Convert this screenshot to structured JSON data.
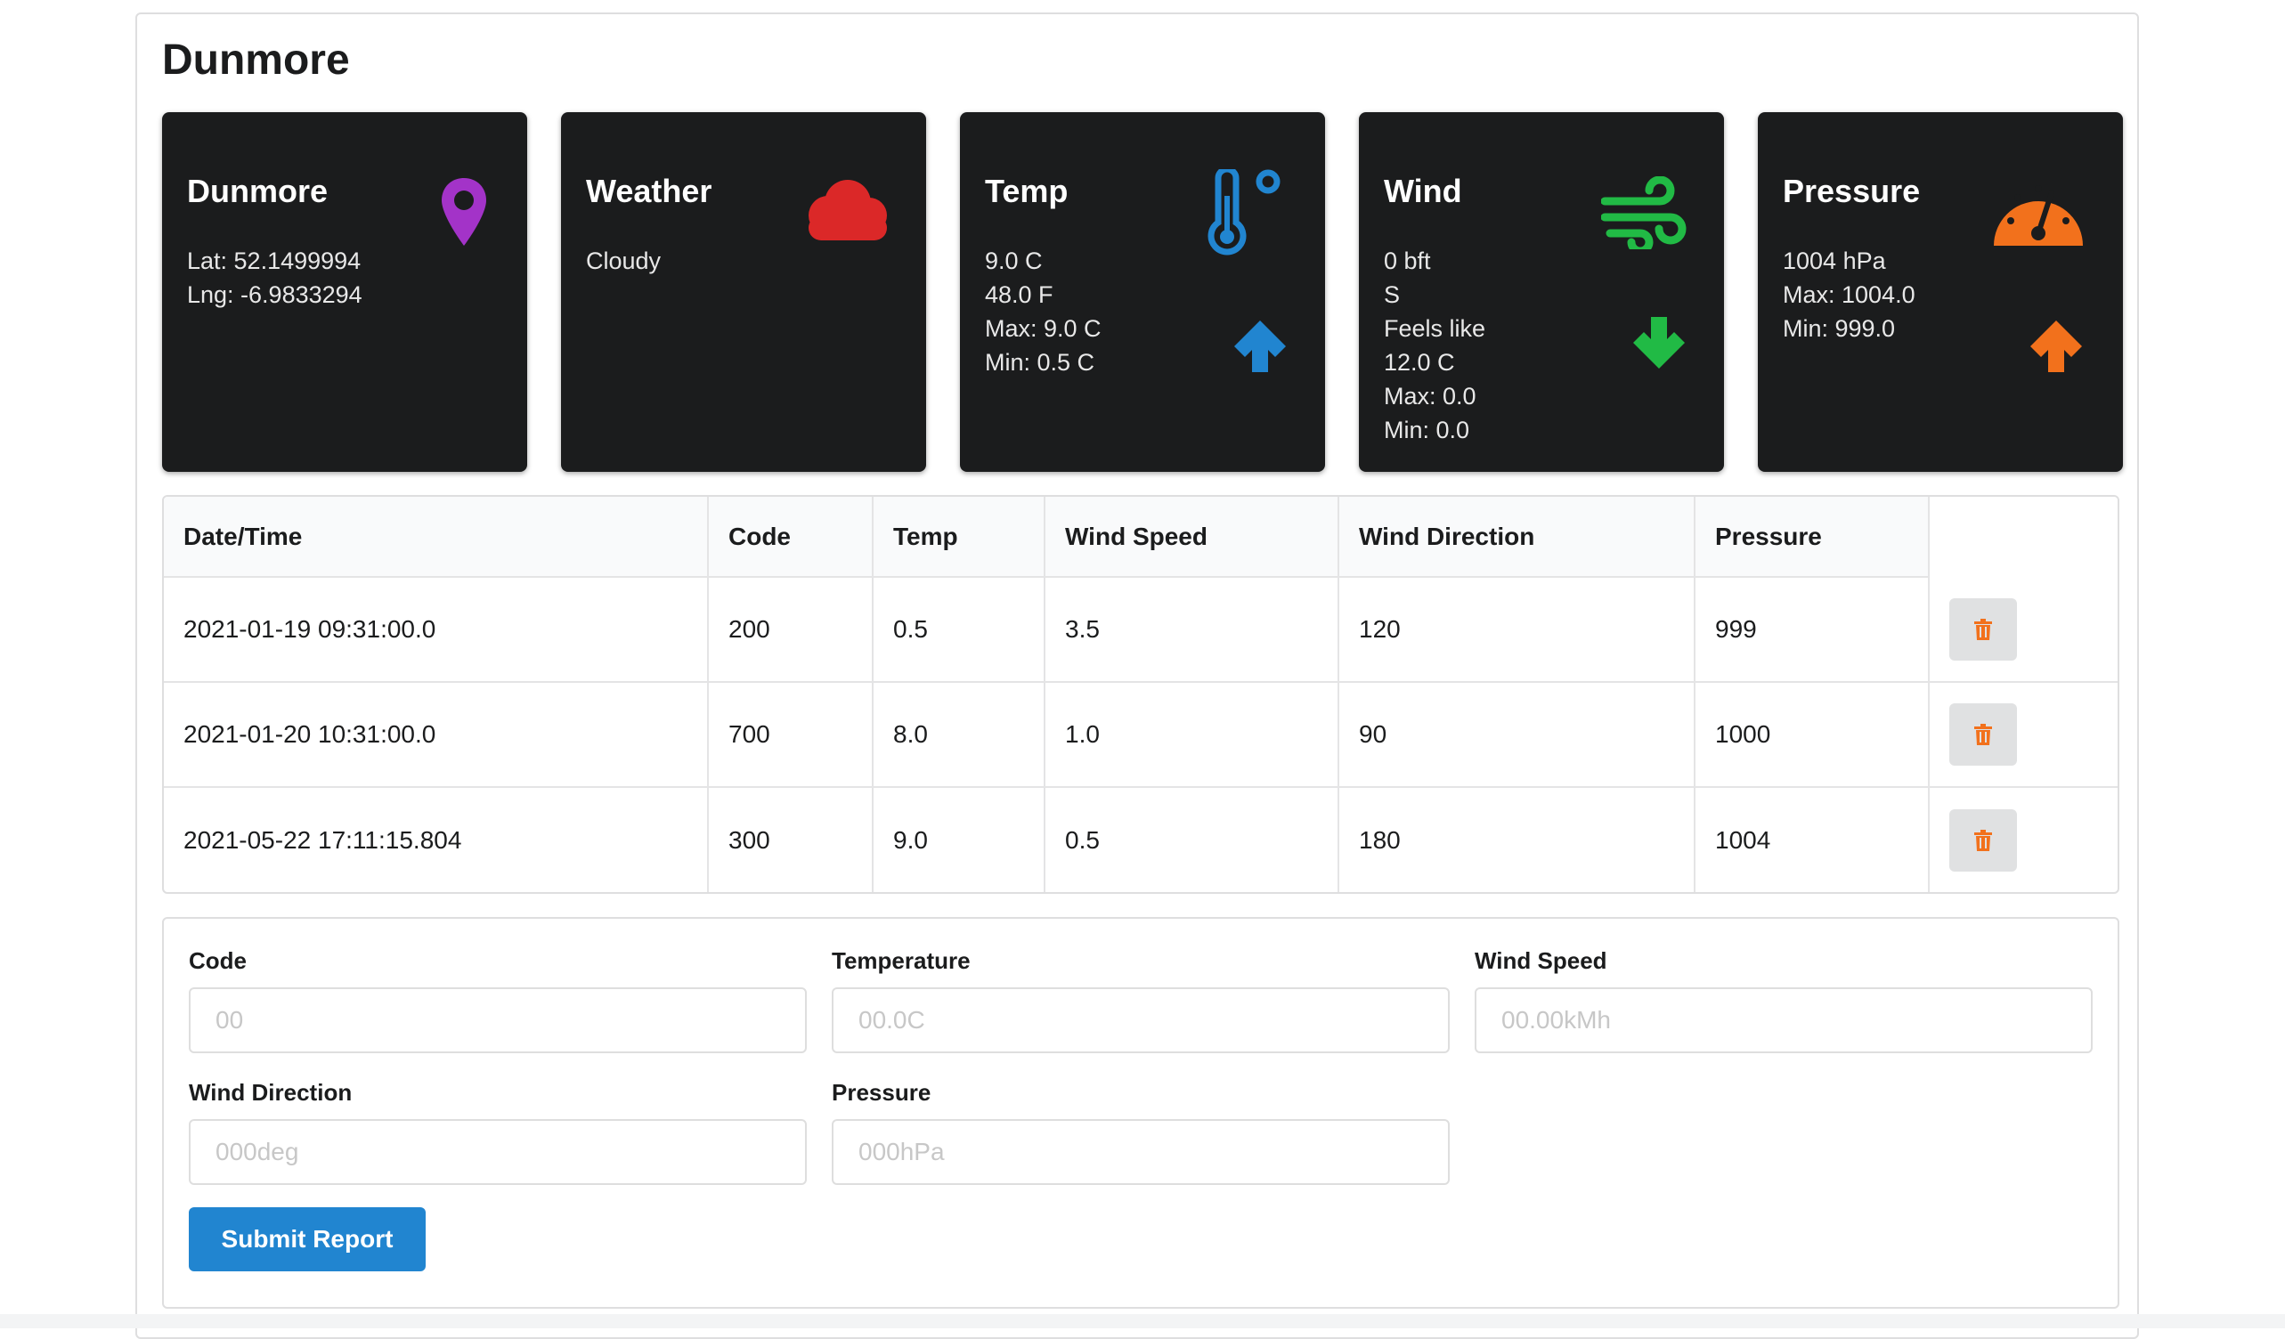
{
  "station": {
    "name": "Dunmore"
  },
  "cards": {
    "location": {
      "title": "Dunmore",
      "lat": "Lat: 52.1499994",
      "lng": "Lng: -6.9833294",
      "icon": "map-pin-icon",
      "color": "#a333c8"
    },
    "weather": {
      "title": "Weather",
      "condition": "Cloudy",
      "icon": "cloud-icon",
      "color": "#db2828"
    },
    "temp": {
      "title": "Temp",
      "celsius": "9.0 C",
      "fahrenheit": "48.0 F",
      "max": "Max: 9.0 C",
      "min": "Min: 0.5 C",
      "icon": "thermometer-icon",
      "trend": "up-arrow-icon",
      "color": "#2185d0"
    },
    "wind": {
      "title": "Wind",
      "bft": "0 bft",
      "direction": "S",
      "feels_label": "Feels like",
      "feels_value": "12.0 C",
      "max": "Max: 0.0",
      "min": "Min: 0.0",
      "icon": "wind-icon",
      "trend": "down-arrow-icon",
      "color": "#21ba45"
    },
    "pressure": {
      "title": "Pressure",
      "value": "1004 hPa",
      "max": "Max: 1004.0",
      "min": "Min: 999.0",
      "icon": "gauge-icon",
      "trend": "up-arrow-icon",
      "color": "#f2711c"
    }
  },
  "table": {
    "headers": [
      "Date/Time",
      "Code",
      "Temp",
      "Wind Speed",
      "Wind Direction",
      "Pressure"
    ],
    "rows": [
      [
        "2021-01-19 09:31:00.0",
        "200",
        "0.5",
        "3.5",
        "120",
        "999"
      ],
      [
        "2021-01-20 10:31:00.0",
        "700",
        "8.0",
        "1.0",
        "90",
        "1000"
      ],
      [
        "2021-05-22 17:11:15.804",
        "300",
        "9.0",
        "0.5",
        "180",
        "1004"
      ]
    ],
    "delete_icon": "trash-icon"
  },
  "form": {
    "code": {
      "label": "Code",
      "placeholder": "00"
    },
    "temperature": {
      "label": "Temperature",
      "placeholder": "00.0C"
    },
    "wind_speed": {
      "label": "Wind Speed",
      "placeholder": "00.00kMh"
    },
    "wind_direction": {
      "label": "Wind Direction",
      "placeholder": "000deg"
    },
    "pressure": {
      "label": "Pressure",
      "placeholder": "000hPa"
    },
    "submit_label": "Submit Report"
  }
}
